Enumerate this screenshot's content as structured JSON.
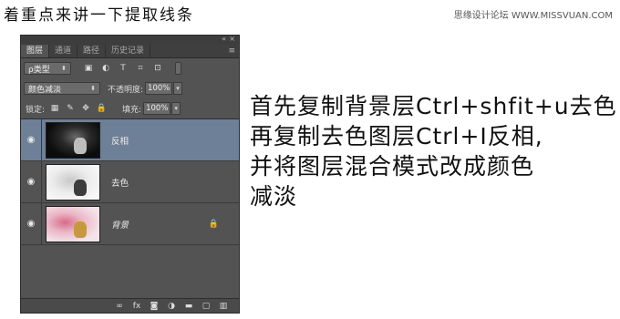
{
  "header": {
    "title": "着重点来讲一下提取线条",
    "watermark": "思缘设计论坛 WWW.MISSVUAN.COM"
  },
  "panel": {
    "tabs": [
      {
        "label": "图层",
        "active": true
      },
      {
        "label": "通道",
        "active": false
      },
      {
        "label": "路径",
        "active": false
      },
      {
        "label": "历史记录",
        "active": false
      }
    ],
    "filter_label": "ρ类型",
    "blend_mode": "颜色减淡",
    "opacity_label": "不透明度:",
    "opacity_value": "100%",
    "lock_label": "锁定:",
    "fill_label": "填充:",
    "fill_value": "100%",
    "layers": [
      {
        "name": "反相",
        "selected": true,
        "thumb": "dark",
        "locked": false
      },
      {
        "name": "去色",
        "selected": false,
        "thumb": "light",
        "locked": false
      },
      {
        "name": "背景",
        "selected": false,
        "thumb": "color",
        "locked": true
      }
    ],
    "selected_color": "#6e8097",
    "panel_bg": "#535353"
  },
  "instructions": {
    "line1": "首先复制背景层Ctrl+shfit+u去色",
    "line2": "再复制去色图层Ctrl+I反相,",
    "line3": "并将图层混合模式改成颜色",
    "line4": "减淡"
  }
}
